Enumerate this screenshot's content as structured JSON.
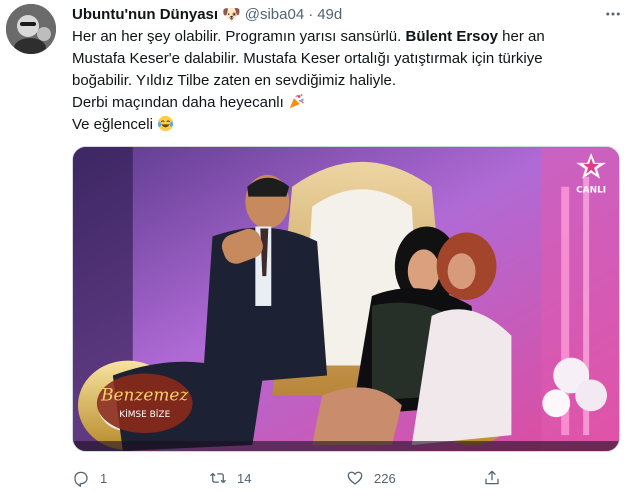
{
  "tweet": {
    "display_name": "Ubuntu'nun Dünyası",
    "name_emoji": "🐶",
    "handle": "@siba04",
    "separator": "·",
    "time": "49d",
    "more_icon": "more-horizontal-icon",
    "lines": [
      {
        "before": "Her an her şey olabilir. Programın yarısı sansürlü. ",
        "bold": "Bülent Ersoy",
        "after": " her an"
      },
      {
        "before": "Mustafa Keser'e dalabilir. Mustafa Keser ortalığı yatıştırmak için türkiye",
        "bold": "",
        "after": ""
      },
      {
        "before": "boğabilir. Yıldız Tilbe zaten en sevdiğimiz haliyle.",
        "bold": "",
        "after": ""
      },
      {
        "before": "Derbi maçından daha heyecanlı",
        "bold": "",
        "after": ""
      },
      {
        "before": "Ve eğlenceli",
        "bold": "",
        "after": ""
      }
    ],
    "line4_emoji": "party-popper-icon",
    "line5_emoji": "laughing-tears-icon",
    "media": {
      "logo_bottom_line1": "Benzemez",
      "logo_bottom_line2": "KİMSE BİZE",
      "channel_label": "CANLI",
      "channel_logo": "star-logo-icon"
    },
    "actions": {
      "reply": {
        "icon": "reply-icon",
        "count": "1"
      },
      "retweet": {
        "icon": "retweet-icon",
        "count": "14"
      },
      "like": {
        "icon": "heart-icon",
        "count": "226"
      },
      "share": {
        "icon": "share-icon",
        "count": ""
      }
    }
  }
}
